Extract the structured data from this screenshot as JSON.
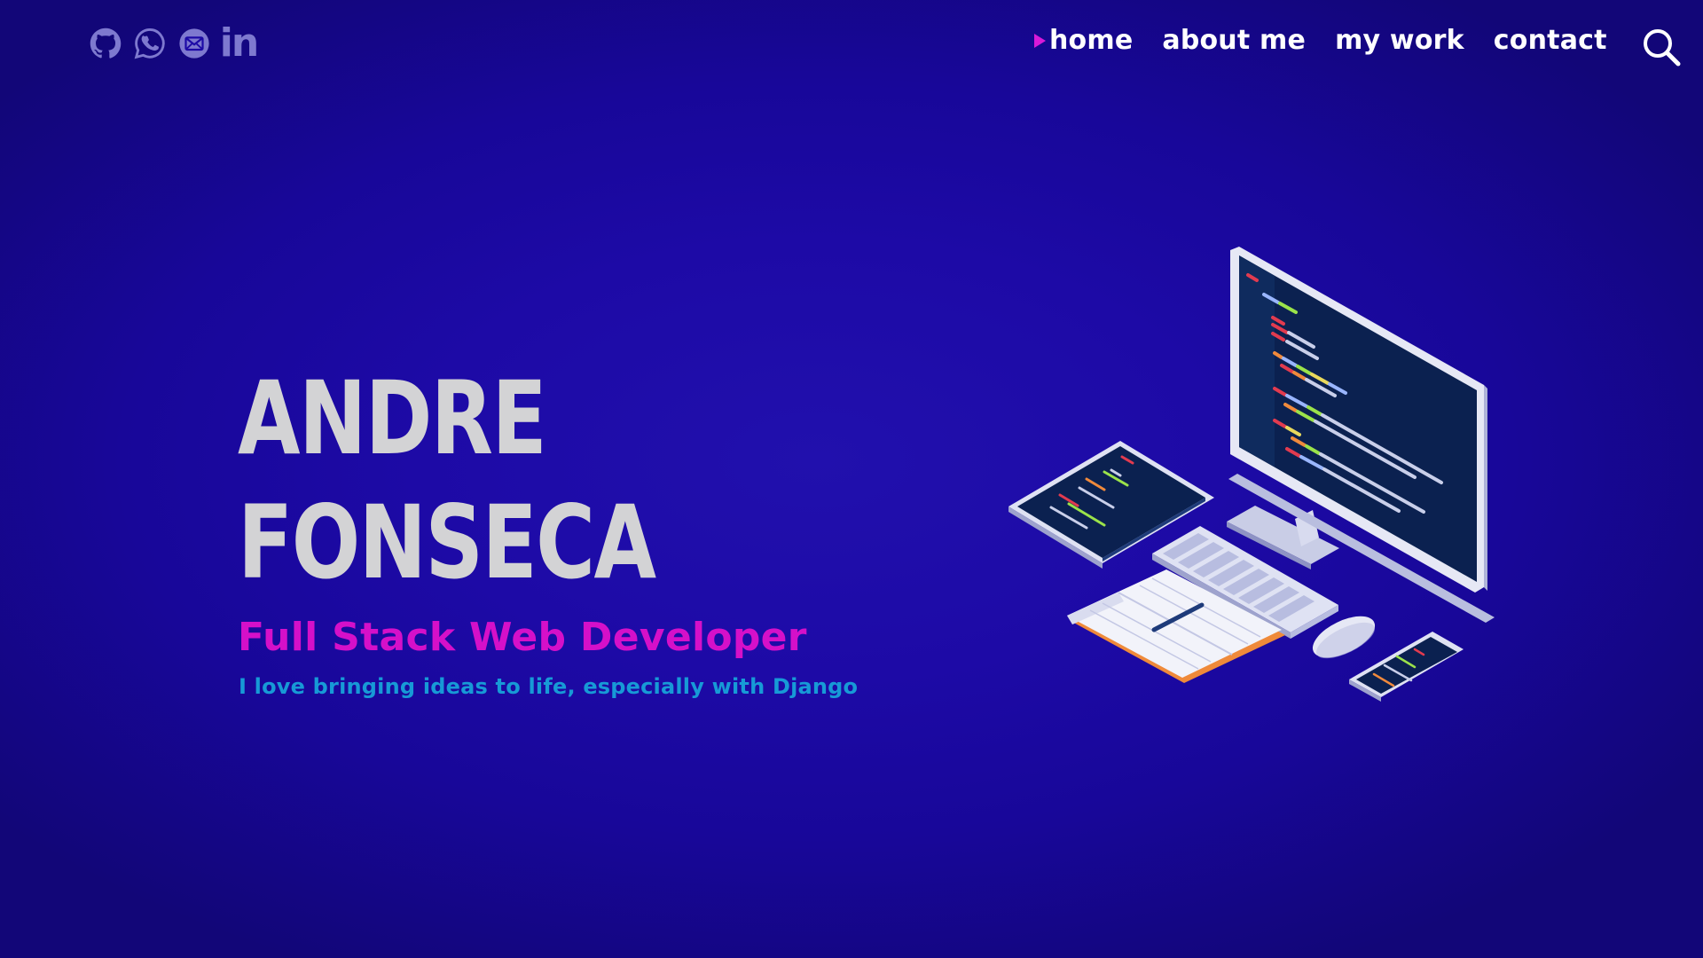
{
  "social": {
    "items": [
      {
        "name": "github-icon"
      },
      {
        "name": "whatsapp-icon"
      },
      {
        "name": "email-icon"
      },
      {
        "name": "linkedin-icon",
        "label": "in"
      }
    ],
    "icon_color": "#7e79cf"
  },
  "nav": {
    "items": [
      {
        "label": "home",
        "active": true
      },
      {
        "label": "about me",
        "active": false
      },
      {
        "label": "my work",
        "active": false
      },
      {
        "label": "contact",
        "active": false
      }
    ],
    "active_marker_color": "#d81ad8"
  },
  "hero": {
    "first_name": "ANDRE",
    "last_name": "FONSECA",
    "role": "Full Stack Web Developer",
    "tagline": "I love bringing ideas to life, especially with Django"
  },
  "colors": {
    "background": "#1d0aa6",
    "name": "#d3d3d5",
    "role": "#d510c9",
    "tagline": "#179ad6"
  }
}
